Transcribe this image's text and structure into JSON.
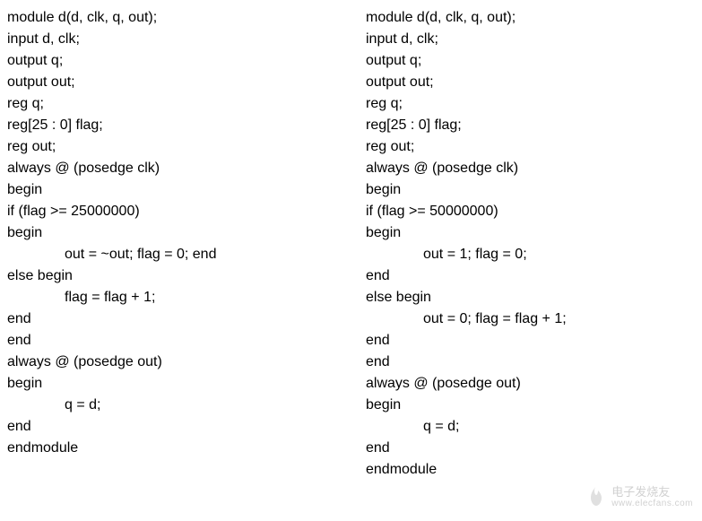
{
  "left": {
    "l0": "module d(d, clk, q, out);",
    "l1": "input d, clk;",
    "l2": "output q;",
    "l3": "output out;",
    "l4": "reg q;",
    "l5": "reg[25 : 0] flag;",
    "l6": "reg out;",
    "l7": "always @ (posedge clk)",
    "l8": "begin",
    "l9": "if (flag >= 25000000)",
    "l10": "begin",
    "l11": "out = ~out; flag = 0; end",
    "l12": "else begin",
    "l13": "flag = flag + 1;",
    "l14": "end",
    "l15": "end",
    "l16": "always @ (posedge out)",
    "l17": "begin",
    "l18": "q = d;",
    "l19": "end",
    "l20": "endmodule"
  },
  "right": {
    "l0": "module d(d, clk, q, out);",
    "l1": "input d, clk;",
    "l2": "output q;",
    "l3": "output out;",
    "l4": "reg q;",
    "l5": "reg[25 : 0] flag;",
    "l6": "reg out;",
    "l7": "always @ (posedge clk)",
    "l8": "begin",
    "l9": "if (flag >= 50000000)",
    "l10": "begin",
    "l11": "out = 1; flag = 0;",
    "l12": "end",
    "l13": "else begin",
    "l14": "out = 0; flag = flag + 1;",
    "l15": "end",
    "l16": "end",
    "l17": "always @ (posedge out)",
    "l18": "begin",
    "l19": "q = d;",
    "l20": "end",
    "l21": "endmodule"
  },
  "watermark": {
    "name": "电子发烧友",
    "url": "www.elecfans.com"
  }
}
